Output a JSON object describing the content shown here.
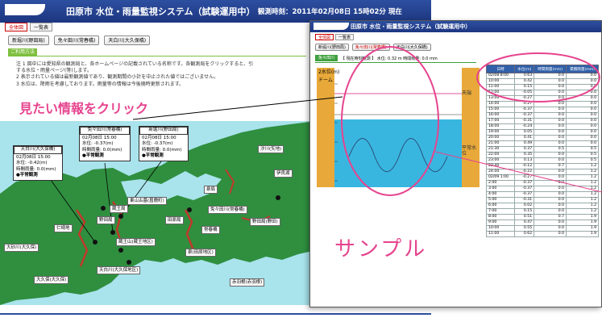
{
  "back_window": {
    "title": "田原市 水位・雨量監視システム（試験運用中）",
    "observation_time": "観測時刻：2011年02月08日 15時02分 現在",
    "tabs": [
      {
        "label": "全体図"
      },
      {
        "label": "一覧表"
      }
    ],
    "select_buttons": [
      {
        "label": "新堀川(野田局)"
      },
      {
        "label": "免々田川(常春橋)"
      },
      {
        "label": "天白川(大久保橋)"
      }
    ],
    "guide_tab": "ご利用方法",
    "notes": [
      "注 1 図中には愛知県の観測局と、各ホームページの記載されている名称です。各観測局をクリックすると、引",
      "      する水位・雨量ページ(等)します。",
      "   2 表示されている値は最新観測値であり、観測期間の小計を中止された値ではございません。",
      "   3 水位は、降雨を考慮しております。雨量等の情報は今後随時更新されます。"
    ],
    "callout": "見たい情報をクリック"
  },
  "map": {
    "stations": [
      {
        "label": "大砂川(大久保)"
      },
      {
        "label": "東山古墓(菖鹿町)"
      },
      {
        "label": "蔵王局"
      },
      {
        "label": "野田局"
      },
      {
        "label": "仁崎地"
      },
      {
        "label": "蔵王山(蔵王地区)"
      },
      {
        "label": "田原局"
      },
      {
        "label": "泉局"
      },
      {
        "label": "伊良湖"
      },
      {
        "label": "常春橋"
      },
      {
        "label": "汐川(矢地)"
      },
      {
        "label": "免々田川(常春橋)"
      },
      {
        "label": "大久保(大久保)"
      },
      {
        "label": "天白川(大久保地区)"
      },
      {
        "label": "泉(田原地区)"
      },
      {
        "label": "野田局(野田)"
      },
      {
        "label": "赤羽根(赤羽根)"
      }
    ],
    "info_boxes": [
      {
        "title": "天白川(大久保橋)",
        "time": "02月08日 15:00",
        "level": "水位: -0.42(m)",
        "rain": "時間雨量: 0.0(mm)",
        "status": "●平常観測"
      },
      {
        "title": "免々田川(常春橋)",
        "time": "02月08日 15:00",
        "level": "水位: -0.37(m)",
        "rain": "時間雨量: 0.0(mm)",
        "status": "●平常観測"
      },
      {
        "title": "新堀川(野田局)",
        "time": "02月08日 15:00",
        "level": "水位: -0.37(m)",
        "rain": "時間雨量: 0.0(mm)",
        "status": "●平常観測"
      }
    ]
  },
  "front_window": {
    "title": "田原市 水位・雨量監視システム（試験運用中）",
    "tabs": [
      {
        "label": "全体図"
      },
      {
        "label": "一覧表"
      }
    ],
    "select_buttons": [
      {
        "label": "新堀川(野田局)"
      },
      {
        "label": "免々田川(常春橋)"
      },
      {
        "label": "天白川(大久保橋)"
      }
    ],
    "station_tab": "免々田川",
    "sub_info": "【 現在時刻観測 】 水位: 0.32 m 時間雨量: 0.0 mm",
    "chart": {
      "top_label": "2水位(m)",
      "mid_label": "ドーム",
      "side_label_top": "天端",
      "side_label_mid": "平常水位"
    },
    "table": {
      "headers": [
        "日時",
        "水位(m)",
        "時間雨量(mm)",
        "累積雨量(mm)"
      ],
      "rows": [
        [
          "02/08 8:00",
          "0.63",
          "0.0",
          "0.0"
        ],
        [
          "10:00",
          "0.42",
          "0.0",
          "0.0"
        ],
        [
          "11:00",
          "0.15",
          "0.0",
          "0.0"
        ],
        [
          "12:00",
          "-0.05",
          "0.0",
          "0.0"
        ],
        [
          "13:00",
          "-0.27",
          "0.0",
          "0.0"
        ],
        [
          "14:00",
          "-0.27",
          "0.0",
          "0.0"
        ],
        [
          "15:00",
          "-0.37",
          "0.0",
          "0.0"
        ],
        [
          "16:00",
          "-0.37",
          "0.0",
          "0.0"
        ],
        [
          "17:00",
          "-0.31",
          "0.0",
          "0.0"
        ],
        [
          "18:00",
          "-0.24",
          "0.0",
          "0.0"
        ],
        [
          "19:00",
          "0.05",
          "0.0",
          "0.0"
        ],
        [
          "20:00",
          "0.41",
          "0.0",
          "0.0"
        ],
        [
          "21:00",
          "0.49",
          "0.0",
          "0.0"
        ],
        [
          "21:30",
          "0.37",
          "0.5",
          "0.5"
        ],
        [
          "22:00",
          "0.35",
          "0.0",
          "0.5"
        ],
        [
          "23:00",
          "0.13",
          "0.0",
          "0.5"
        ],
        [
          "23:40",
          "-0.12",
          "0.7",
          "1.2"
        ],
        [
          "24:00",
          "-0.22",
          "0.0",
          "1.2"
        ],
        [
          "02/09 1:00",
          "-0.27",
          "0.0",
          "1.2"
        ],
        [
          "2:00",
          "-0.37",
          "0.0",
          "1.2"
        ],
        [
          "3:00",
          "-0.37",
          "0.0",
          "1.2"
        ],
        [
          "4:00",
          "-0.37",
          "0.0",
          "1.2"
        ],
        [
          "5:00",
          "-0.31",
          "0.0",
          "1.2"
        ],
        [
          "6:00",
          "0.02",
          "0.0",
          "1.2"
        ],
        [
          "7:00",
          "0.15",
          "0.0",
          "1.2"
        ],
        [
          "8:00",
          "0.51",
          "0.7",
          "1.9"
        ],
        [
          "9:00",
          "0.47",
          "0.0",
          "1.9"
        ],
        [
          "10:00",
          "0.55",
          "0.0",
          "1.9"
        ],
        [
          "11:00",
          "0.62",
          "0.0",
          "1.9"
        ]
      ]
    },
    "sample_label": "サンプル"
  },
  "colors": {
    "header_blue": "#2d4fa0",
    "accent_pink": "#e6448e",
    "land_green": "#2f8f3f",
    "sea_blue": "#a9e3ec",
    "water_blue": "#39b6e0",
    "bank_orange": "#e8a93a"
  }
}
